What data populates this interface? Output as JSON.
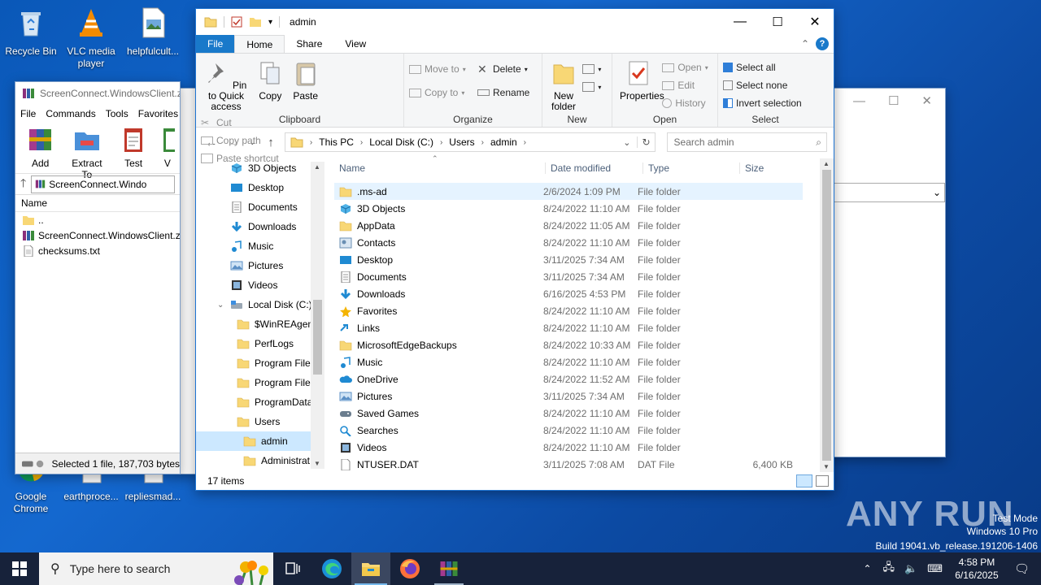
{
  "desktop": {
    "icons": [
      {
        "label": "Recycle Bin",
        "icon": "recycle-bin-icon"
      },
      {
        "label": "VLC media player",
        "icon": "vlc-icon"
      },
      {
        "label": "helpfulcult...",
        "icon": "image-file-icon"
      },
      {
        "label": "Google Chrome",
        "icon": "chrome-icon"
      },
      {
        "label": "earthproce...",
        "icon": "file-icon"
      },
      {
        "label": "repliesmad...",
        "icon": "file-icon"
      }
    ],
    "watermark": "ANY RUN",
    "test_mode": [
      "Test Mode",
      "Windows 10 Pro",
      "Build 19041.vb_release.191206-1406"
    ]
  },
  "winrar": {
    "title": "ScreenConnect.WindowsClient.z",
    "menu": [
      "File",
      "Commands",
      "Tools",
      "Favorites"
    ],
    "tools": [
      "Add",
      "Extract To",
      "Test",
      "V"
    ],
    "address": "ScreenConnect.Windo",
    "column": "Name",
    "rows": [
      {
        "name": "..",
        "icon": "folder-icon"
      },
      {
        "name": "ScreenConnect.WindowsClient.zip",
        "icon": "zip-archive-icon"
      },
      {
        "name": "checksums.txt",
        "icon": "text-file-icon"
      }
    ],
    "status": "Selected 1 file, 187,703 bytes"
  },
  "explorer": {
    "title": "admin",
    "tabs": [
      "File",
      "Home",
      "Share",
      "View"
    ],
    "ribbon": {
      "clipboard": {
        "label": "Clipboard",
        "pin": "Pin to Quick access",
        "copy": "Copy",
        "paste": "Paste",
        "cut": "Cut",
        "copy_path": "Copy path",
        "paste_shortcut": "Paste shortcut"
      },
      "organize": {
        "label": "Organize",
        "move_to": "Move to",
        "copy_to": "Copy to",
        "delete": "Delete",
        "rename": "Rename"
      },
      "new": {
        "label": "New",
        "new_folder": "New folder"
      },
      "open": {
        "label": "Open",
        "properties": "Properties",
        "open": "Open",
        "edit": "Edit",
        "history": "History"
      },
      "select": {
        "label": "Select",
        "select_all": "Select all",
        "select_none": "Select none",
        "invert": "Invert selection"
      }
    },
    "breadcrumb": [
      "This PC",
      "Local Disk (C:)",
      "Users",
      "admin"
    ],
    "search_placeholder": "Search admin",
    "nav_items": [
      {
        "label": "3D Objects",
        "indent": 0,
        "icon": "3d-objects-icon"
      },
      {
        "label": "Desktop",
        "indent": 0,
        "icon": "desktop-folder-icon"
      },
      {
        "label": "Documents",
        "indent": 0,
        "icon": "documents-icon"
      },
      {
        "label": "Downloads",
        "indent": 0,
        "icon": "downloads-icon"
      },
      {
        "label": "Music",
        "indent": 0,
        "icon": "music-icon"
      },
      {
        "label": "Pictures",
        "indent": 0,
        "icon": "pictures-icon"
      },
      {
        "label": "Videos",
        "indent": 0,
        "icon": "videos-icon"
      },
      {
        "label": "Local Disk (C:)",
        "indent": 0,
        "icon": "drive-icon"
      },
      {
        "label": "$WinREAgent",
        "indent": 1,
        "icon": "folder-icon"
      },
      {
        "label": "PerfLogs",
        "indent": 1,
        "icon": "folder-icon"
      },
      {
        "label": "Program Files",
        "indent": 1,
        "icon": "folder-icon"
      },
      {
        "label": "Program Files",
        "indent": 1,
        "icon": "folder-icon"
      },
      {
        "label": "ProgramData",
        "indent": 1,
        "icon": "folder-icon"
      },
      {
        "label": "Users",
        "indent": 1,
        "icon": "folder-icon"
      },
      {
        "label": "admin",
        "indent": 2,
        "icon": "folder-icon",
        "selected": true
      },
      {
        "label": "Administrat",
        "indent": 2,
        "icon": "folder-icon"
      }
    ],
    "columns": [
      "Name",
      "Date modified",
      "Type",
      "Size"
    ],
    "files": [
      {
        "name": ".ms-ad",
        "date": "2/6/2024 1:09 PM",
        "type": "File folder",
        "size": "",
        "icon": "folder-icon",
        "selected": true
      },
      {
        "name": "3D Objects",
        "date": "8/24/2022 11:10 AM",
        "type": "File folder",
        "size": "",
        "icon": "3d-objects-icon"
      },
      {
        "name": "AppData",
        "date": "8/24/2022 11:05 AM",
        "type": "File folder",
        "size": "",
        "icon": "folder-icon"
      },
      {
        "name": "Contacts",
        "date": "8/24/2022 11:10 AM",
        "type": "File folder",
        "size": "",
        "icon": "contacts-icon"
      },
      {
        "name": "Desktop",
        "date": "3/11/2025 7:34 AM",
        "type": "File folder",
        "size": "",
        "icon": "desktop-folder-icon"
      },
      {
        "name": "Documents",
        "date": "3/11/2025 7:34 AM",
        "type": "File folder",
        "size": "",
        "icon": "documents-icon"
      },
      {
        "name": "Downloads",
        "date": "6/16/2025 4:53 PM",
        "type": "File folder",
        "size": "",
        "icon": "downloads-icon"
      },
      {
        "name": "Favorites",
        "date": "8/24/2022 11:10 AM",
        "type": "File folder",
        "size": "",
        "icon": "favorites-icon"
      },
      {
        "name": "Links",
        "date": "8/24/2022 11:10 AM",
        "type": "File folder",
        "size": "",
        "icon": "links-icon"
      },
      {
        "name": "MicrosoftEdgeBackups",
        "date": "8/24/2022 10:33 AM",
        "type": "File folder",
        "size": "",
        "icon": "folder-icon"
      },
      {
        "name": "Music",
        "date": "8/24/2022 11:10 AM",
        "type": "File folder",
        "size": "",
        "icon": "music-icon"
      },
      {
        "name": "OneDrive",
        "date": "8/24/2022 11:52 AM",
        "type": "File folder",
        "size": "",
        "icon": "onedrive-icon"
      },
      {
        "name": "Pictures",
        "date": "3/11/2025 7:34 AM",
        "type": "File folder",
        "size": "",
        "icon": "pictures-icon"
      },
      {
        "name": "Saved Games",
        "date": "8/24/2022 11:10 AM",
        "type": "File folder",
        "size": "",
        "icon": "saved-games-icon"
      },
      {
        "name": "Searches",
        "date": "8/24/2022 11:10 AM",
        "type": "File folder",
        "size": "",
        "icon": "searches-icon"
      },
      {
        "name": "Videos",
        "date": "8/24/2022 11:10 AM",
        "type": "File folder",
        "size": "",
        "icon": "videos-icon"
      },
      {
        "name": "NTUSER.DAT",
        "date": "3/11/2025 7:08 AM",
        "type": "DAT File",
        "size": "6,400 KB",
        "icon": "file-icon"
      }
    ],
    "status": "17 items"
  },
  "taskbar": {
    "search_placeholder": "Type here to search",
    "time": "4:58 PM",
    "date": "6/16/2025",
    "apps": [
      "task-view-icon",
      "edge-icon",
      "file-explorer-icon",
      "firefox-icon",
      "winrar-icon"
    ]
  },
  "colors": {
    "accent": "#1979ca",
    "selection": "#cce8ff",
    "folder": "#f8d775",
    "taskbar": "#17223a"
  }
}
